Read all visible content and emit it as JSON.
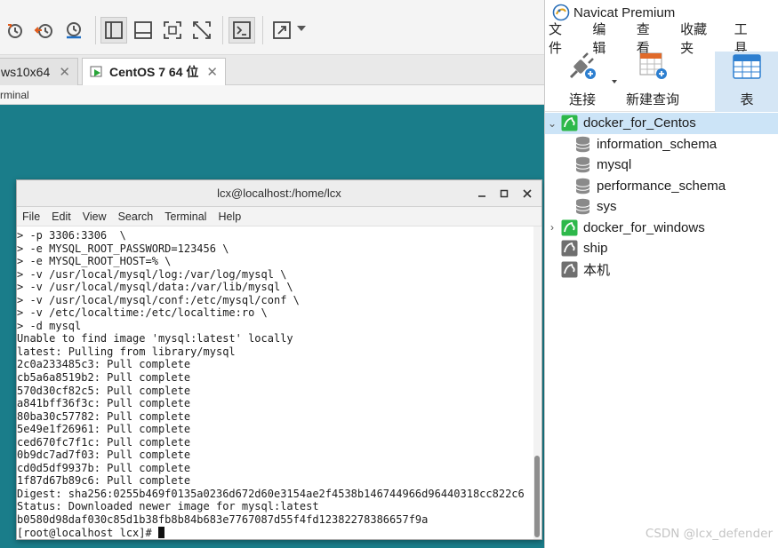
{
  "vmware": {
    "tabs": [
      {
        "label": "ws10x64",
        "close": "✕"
      },
      {
        "label": "CentOS 7 64 位",
        "close": "✕"
      }
    ],
    "subbar_text": "rminal"
  },
  "terminal": {
    "title": "lcx@localhost:/home/lcx",
    "menu": [
      "File",
      "Edit",
      "View",
      "Search",
      "Terminal",
      "Help"
    ],
    "lines": [
      "> -p 3306:3306  \\",
      "> -e MYSQL_ROOT_PASSWORD=123456 \\",
      "> -e MYSQL_ROOT_HOST=% \\",
      "> -v /usr/local/mysql/log:/var/log/mysql \\",
      "> -v /usr/local/mysql/data:/var/lib/mysql \\",
      "> -v /usr/local/mysql/conf:/etc/mysql/conf \\",
      "> -v /etc/localtime:/etc/localtime:ro \\",
      "> -d mysql",
      "Unable to find image 'mysql:latest' locally",
      "latest: Pulling from library/mysql",
      "2c0a233485c3: Pull complete",
      "cb5a6a8519b2: Pull complete",
      "570d30cf82c5: Pull complete",
      "a841bff36f3c: Pull complete",
      "80ba30c57782: Pull complete",
      "5e49e1f26961: Pull complete",
      "ced670fc7f1c: Pull complete",
      "0b9dc7ad7f03: Pull complete",
      "cd0d5df9937b: Pull complete",
      "1f87d67b89c6: Pull complete",
      "Digest: sha256:0255b469f0135a0236d672d60e3154ae2f4538b146744966d96440318cc822c6",
      "Status: Downloaded newer image for mysql:latest",
      "b0580d98daf030c85d1b38fb8b84b683e7767087d55f4fd12382278386657f9a"
    ],
    "prompt": "[root@localhost lcx]# "
  },
  "navicat": {
    "title": "Navicat Premium",
    "menu": [
      "文件",
      "编辑",
      "查看",
      "收藏夹",
      "工具"
    ],
    "toolbar": {
      "connect": "连接",
      "new_query": "新建查询",
      "table": "表"
    },
    "tree": {
      "conn1": "docker_for_Centos",
      "dbs": [
        "information_schema",
        "mysql",
        "performance_schema",
        "sys"
      ],
      "conn2": "docker_for_windows",
      "conn3": "ship",
      "conn4": "本机"
    }
  },
  "watermark": "CSDN @lcx_defender",
  "colors": {
    "desktop": "#1a7d8a",
    "mysql_green": "#2db84a",
    "selection": "#cce4f7",
    "accent_blue": "#1f6fc4"
  }
}
